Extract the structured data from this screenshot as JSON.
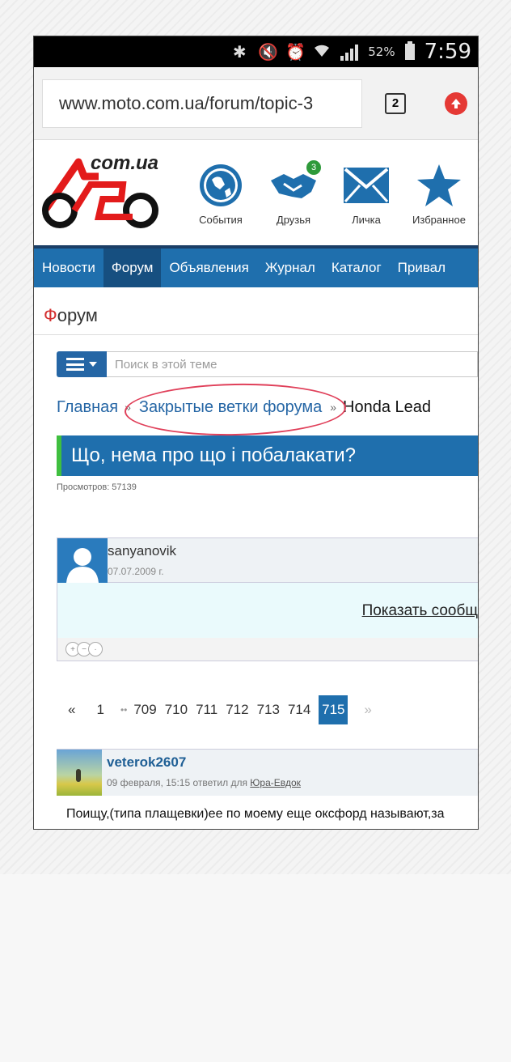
{
  "status_bar": {
    "battery_percent": "52%",
    "time": "7:59",
    "icons": [
      "bluetooth-icon",
      "mute-icon",
      "alarm-icon",
      "wifi-icon",
      "signal-icon",
      "battery-icon"
    ]
  },
  "browser": {
    "url": "www.moto.com.ua/forum/topic-3",
    "tab_count": "2"
  },
  "site": {
    "logo_text": "com.ua",
    "header_icons": [
      {
        "label": "События",
        "icon": "globe-icon"
      },
      {
        "label": "Друзья",
        "icon": "handshake-icon",
        "badge": "3"
      },
      {
        "label": "Личка",
        "icon": "envelope-icon"
      },
      {
        "label": "Избранное",
        "icon": "star-icon"
      }
    ],
    "nav": [
      "Новости",
      "Форум",
      "Объявления",
      "Журнал",
      "Каталог",
      "Привал"
    ],
    "nav_active": "Форум"
  },
  "page": {
    "section_title_first": "Ф",
    "section_title_rest": "орум",
    "search_placeholder": "Поиск в этой теме",
    "breadcrumb": {
      "home": "Главная",
      "separator": "»",
      "closed": "Закрытые ветки форума",
      "current": "Honda Lead"
    },
    "topic_title": "Що, нема про що і побалакати?",
    "views": "Просмотров: 57139"
  },
  "post1": {
    "author": "sanyanovik",
    "date": "07.07.2009 г.",
    "show_link": "Показать сообщ"
  },
  "pager": {
    "prev": "«",
    "first": "1",
    "dots": "••",
    "pages": [
      "709",
      "710",
      "711",
      "712",
      "713",
      "714"
    ],
    "current": "715",
    "next": "»"
  },
  "post2": {
    "author": "veterok2607",
    "meta_prefix": "09 февраля, 15:15 ответил для",
    "reply_to": "Юра-Евдок",
    "text": "Поищу,(типа плащевки)ее по моему еще оксфорд называют,за"
  },
  "colors": {
    "nav_bg": "#1f6fad",
    "nav_active": "#164f80",
    "accent_green": "#3fbf3f",
    "annotation": "#e0405a"
  }
}
